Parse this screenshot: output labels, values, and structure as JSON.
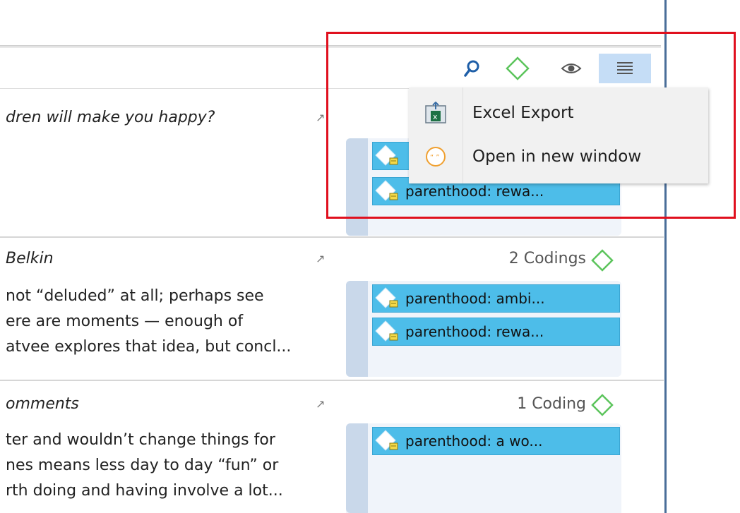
{
  "toolbar": {
    "search_icon": "search-icon",
    "code_icon": "code-diamond-icon",
    "eye_icon": "eye-icon",
    "menu_icon": "hamburger-menu-icon",
    "active_bg": "#c5ddf6"
  },
  "menu": {
    "items": [
      {
        "label": "Excel Export",
        "icon": "excel-export-icon"
      },
      {
        "label": "Open in new window",
        "icon": "new-window-icon"
      }
    ]
  },
  "documents": [
    {
      "title": "dren will make you happy?",
      "lines": [],
      "count_label": "",
      "codings": [
        "",
        "parenthood: rewa..."
      ]
    },
    {
      "title": "Belkin",
      "lines": [
        "not “deluded” at all; perhaps see",
        "ere are moments — enough of",
        "atvee explores that idea, but concl..."
      ],
      "count_label": "2 Codings",
      "codings": [
        "parenthood: ambi...",
        "parenthood: rewa..."
      ]
    },
    {
      "title": "omments",
      "lines": [
        "ter and wouldn’t change things for",
        "nes means less day to day “fun” or",
        "rth doing and having involve a lot..."
      ],
      "count_label": "1 Coding",
      "codings": [
        "parenthood: a wo..."
      ]
    }
  ],
  "colors": {
    "code_tag": "#4dbde9",
    "code_diamond": "#5cc45c",
    "highlight": "#e0101e",
    "divider": "#4a6e99"
  }
}
